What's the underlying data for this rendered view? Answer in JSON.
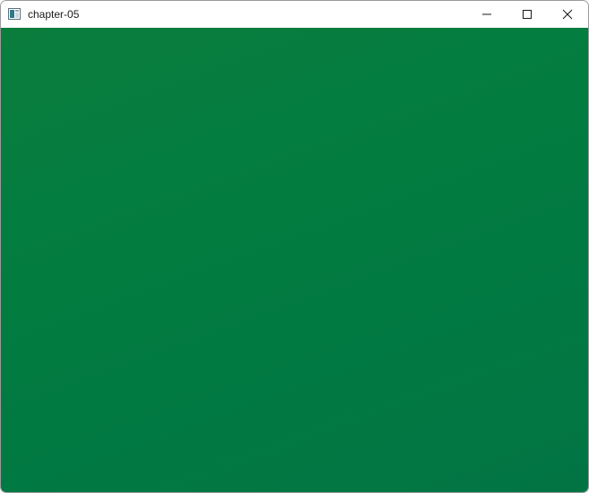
{
  "window": {
    "title": "chapter-05",
    "controls": {
      "minimize_icon": "minimize-icon",
      "maximize_icon": "maximize-icon",
      "close_icon": "close-icon"
    }
  },
  "canvas": {
    "background_color": "#047d40"
  }
}
